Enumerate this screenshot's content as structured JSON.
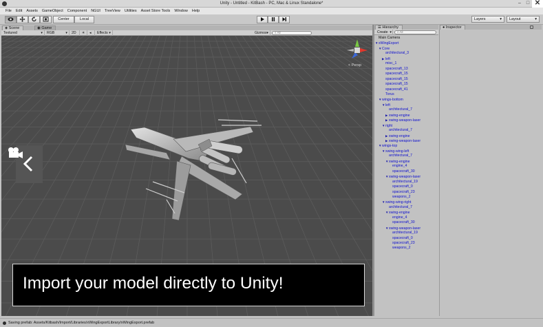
{
  "window": {
    "title": "Unity - Untitled - KitBash - PC, Mac & Linux Standalone*",
    "controls": [
      "–",
      "□",
      "✕"
    ]
  },
  "menu": [
    "File",
    "Edit",
    "Assets",
    "GameObject",
    "Component",
    "NGUI",
    "TreeView",
    "Utilities",
    "Asset Store Tools",
    "Window",
    "Help"
  ],
  "toolbar": {
    "pivot": "Center",
    "space": "Local",
    "layers": "Layers",
    "layout": "Layout",
    "tool_icons": [
      "hand-icon",
      "move-icon",
      "rotate-icon",
      "scale-icon"
    ],
    "play_icons": [
      "play-icon",
      "pause-icon",
      "step-icon"
    ]
  },
  "scene": {
    "tabs": [
      "Scene",
      "Game"
    ],
    "shading": "Textured",
    "render": "RGB",
    "mode": "2D",
    "effects": "Effects",
    "gizmos": "Gizmos",
    "search_placeholder": "All",
    "persp": "Persp",
    "caption": "Import your model directly to Unity!"
  },
  "hierarchy": {
    "tab": "Hierarchy",
    "create": "Create",
    "search_placeholder": "All",
    "items": [
      {
        "label": "Main Camera",
        "depth": 0,
        "arrow": "",
        "color": "black"
      },
      {
        "label": "xWingExport",
        "depth": 0,
        "arrow": "down",
        "color": "blue"
      },
      {
        "label": "Core",
        "depth": 1,
        "arrow": "down",
        "color": "blue"
      },
      {
        "label": "architectural_3",
        "depth": 2,
        "arrow": "",
        "color": "blue"
      },
      {
        "label": "left",
        "depth": 2,
        "arrow": "right",
        "color": "blue"
      },
      {
        "label": "misc_1",
        "depth": 2,
        "arrow": "",
        "color": "blue"
      },
      {
        "label": "spacecraft_13",
        "depth": 2,
        "arrow": "",
        "color": "blue"
      },
      {
        "label": "spacecraft_15",
        "depth": 2,
        "arrow": "",
        "color": "blue"
      },
      {
        "label": "spacecraft_15",
        "depth": 2,
        "arrow": "",
        "color": "blue"
      },
      {
        "label": "spacecraft_15",
        "depth": 2,
        "arrow": "",
        "color": "blue"
      },
      {
        "label": "spacecraft_41",
        "depth": 2,
        "arrow": "",
        "color": "blue"
      },
      {
        "label": "Torus",
        "depth": 2,
        "arrow": "",
        "color": "blue"
      },
      {
        "label": "wings-bottom",
        "depth": 1,
        "arrow": "down",
        "color": "blue"
      },
      {
        "label": "left",
        "depth": 2,
        "arrow": "down",
        "color": "blue"
      },
      {
        "label": "architectural_7",
        "depth": 3,
        "arrow": "",
        "color": "blue"
      },
      {
        "label": "xwing-engine",
        "depth": 3,
        "arrow": "right",
        "color": "blue"
      },
      {
        "label": "xwing-weapon-laser",
        "depth": 3,
        "arrow": "right",
        "color": "blue"
      },
      {
        "label": "right",
        "depth": 2,
        "arrow": "down",
        "color": "blue"
      },
      {
        "label": "architectural_7",
        "depth": 3,
        "arrow": "",
        "color": "blue"
      },
      {
        "label": "xwing-engine",
        "depth": 3,
        "arrow": "right",
        "color": "blue"
      },
      {
        "label": "xwing-weapon-laser",
        "depth": 3,
        "arrow": "right",
        "color": "blue"
      },
      {
        "label": "wings-top",
        "depth": 1,
        "arrow": "down",
        "color": "blue"
      },
      {
        "label": "xwing-wing-left",
        "depth": 2,
        "arrow": "down",
        "color": "blue"
      },
      {
        "label": "architectural_7",
        "depth": 3,
        "arrow": "",
        "color": "blue"
      },
      {
        "label": "xwing-engine",
        "depth": 3,
        "arrow": "down",
        "color": "blue"
      },
      {
        "label": "engine_4",
        "depth": 4,
        "arrow": "",
        "color": "blue"
      },
      {
        "label": "spacecraft_30",
        "depth": 4,
        "arrow": "",
        "color": "blue"
      },
      {
        "label": "xwing-weapon-laser",
        "depth": 3,
        "arrow": "down",
        "color": "blue"
      },
      {
        "label": "architectural_19",
        "depth": 4,
        "arrow": "",
        "color": "blue"
      },
      {
        "label": "spacecraft_0",
        "depth": 4,
        "arrow": "",
        "color": "blue"
      },
      {
        "label": "spacecraft_23",
        "depth": 4,
        "arrow": "",
        "color": "blue"
      },
      {
        "label": "weapons_2",
        "depth": 4,
        "arrow": "",
        "color": "blue"
      },
      {
        "label": "xwing-wing-right",
        "depth": 2,
        "arrow": "down",
        "color": "blue"
      },
      {
        "label": "architectural_7",
        "depth": 3,
        "arrow": "",
        "color": "blue"
      },
      {
        "label": "xwing-engine",
        "depth": 3,
        "arrow": "down",
        "color": "blue"
      },
      {
        "label": "engine_4",
        "depth": 4,
        "arrow": "",
        "color": "blue"
      },
      {
        "label": "spacecraft_30",
        "depth": 4,
        "arrow": "",
        "color": "blue"
      },
      {
        "label": "xwing-weapon-laser",
        "depth": 3,
        "arrow": "down",
        "color": "blue"
      },
      {
        "label": "architectural_19",
        "depth": 4,
        "arrow": "",
        "color": "blue"
      },
      {
        "label": "spacecraft_0",
        "depth": 4,
        "arrow": "",
        "color": "blue"
      },
      {
        "label": "spacecraft_23",
        "depth": 4,
        "arrow": "",
        "color": "blue"
      },
      {
        "label": "weapons_2",
        "depth": 4,
        "arrow": "",
        "color": "blue"
      }
    ]
  },
  "inspector": {
    "tab": "Inspector"
  },
  "status": {
    "text": "Saving prefab: Assets/Kitbash/Import/Libraries/xWingExportLibrary/xWingExport.prefab"
  },
  "colors": {
    "scene_bg": "#4b4b4b",
    "grid": "#5a5a5a",
    "hierarchy_link": "#0d0ed0",
    "panel": "#c2c2c2"
  }
}
